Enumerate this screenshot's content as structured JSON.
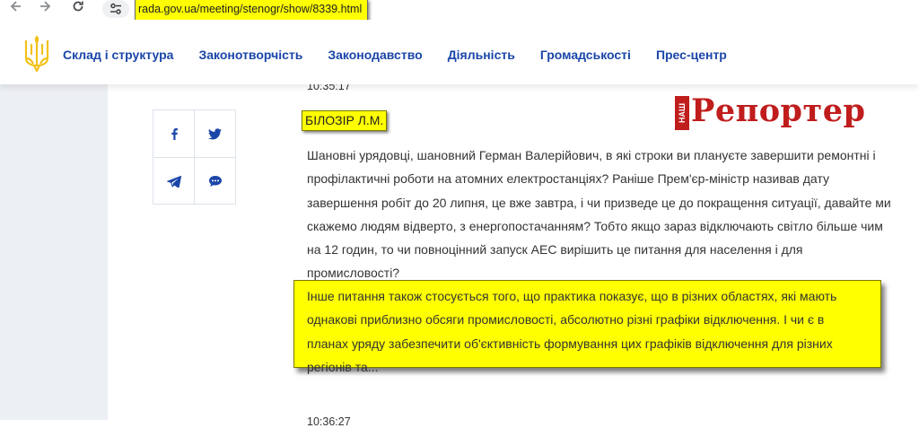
{
  "browser": {
    "url": "rada.gov.ua/meeting/stenogr/show/8339.html",
    "back_icon": "arrow-left-icon",
    "forward_icon": "arrow-right-icon",
    "reload_icon": "reload-icon",
    "site_settings_icon": "tune-icon"
  },
  "header": {
    "logo_icon": "ukraine-trident-icon",
    "menu": [
      {
        "label": "Склад і структура"
      },
      {
        "label": "Законотворчість"
      },
      {
        "label": "Законодавство"
      },
      {
        "label": "Діяльність"
      },
      {
        "label": "Громадськості"
      },
      {
        "label": "Прес-центр"
      }
    ]
  },
  "share": {
    "facebook_icon": "facebook-icon",
    "twitter_icon": "twitter-icon",
    "telegram_icon": "telegram-icon",
    "comment_icon": "chat-bubble-icon"
  },
  "transcript": {
    "time_top": "10:35:17",
    "speaker": "БІЛОЗІР Л.М.",
    "paragraph_1": "Шановні урядовці, шановний Герман Валерійович, в які строки ви плануєте завершити ремонтні і профілактичні роботи на атомних електростанціях? Раніше Прем'єр-міністр називав дату завершення робіт до 20 липня, це вже завтра, і чи призведе це до покращення ситуації, давайте ми скажемо людям відверто, з енергопостачанням? Тобто якщо зараз відключають світло більше чим на 12 годин, то чи повноцінний запуск АЕС вирішить це питання для населення і для промисловості?",
    "paragraph_2": "Інше питання також стосується того, що практика показує, що в різних областях, які мають однакові приблизно обсяги промисловості, абсолютно різні графіки відключення. І чи є в планах уряду забезпечити об'єктивність формування цих графіків відключення для різних регіонів та...",
    "time_bottom": "10:36:27"
  },
  "watermark": {
    "small": "НАШ",
    "main": "Репортер"
  },
  "colors": {
    "nav_blue": "#1a46a8",
    "highlight_yellow": "#ffff00",
    "logo_red": "#c01d1d",
    "rail_gray": "#eceff3",
    "trident_gold": "#f2c21a"
  }
}
